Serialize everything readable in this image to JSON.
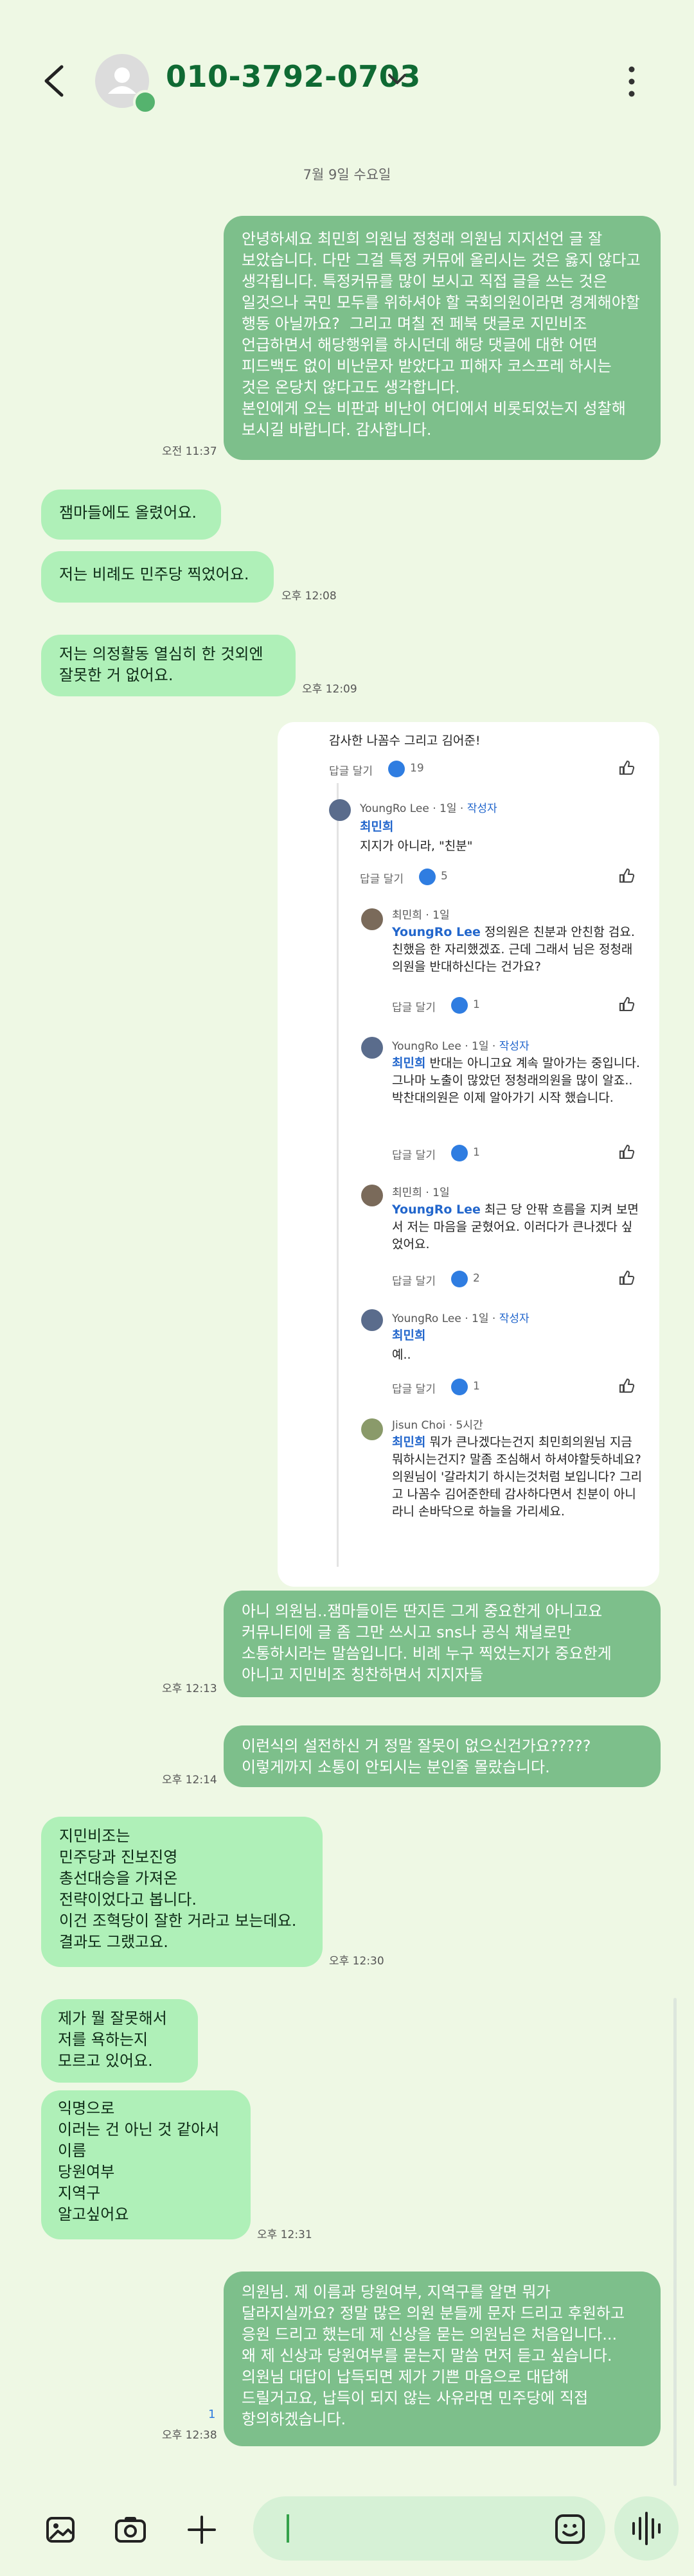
{
  "header": {
    "contact": "010-3792-0703"
  },
  "date_divider": "7월 9일 수요일",
  "messages": {
    "m1": {
      "text": "안녕하세요 최민희 의원님 정청래 의원님 지지선언 글 잘 보았습니다. 다만 그걸 특정 커뮤에 올리시는 것은 옳지 않다고 생각됩니다. 특정커뮤를 많이 보시고 직접 글을 쓰는 것은 일것으나 국민 모두를 위하셔야 할 국회의원이라면 경계해야할 행동 아닐까요?  그리고 며칠 전 페북 댓글로 지민비조 언급하면서 해당행위를 하시던데 해당 댓글에 대한 어떤 피드백도 없이 비난문자 받았다고 피해자 코스프레 하시는 것은 온당치 않다고도 생각합니다.\n본인에게 오는 비판과 비난이 어디에서 비롯되었는지 성찰해 보시길 바랍니다. 감사합니다.",
      "time": "오전 11:37"
    },
    "m2": {
      "text": "잼마들에도 올렸어요."
    },
    "m3": {
      "text": "저는 비례도 민주당 찍었어요.",
      "time": "오후 12:08"
    },
    "m4": {
      "text": "저는 의정활동 열심히 한 것외엔\n잘못한 거 없어요.",
      "time": "오후 12:09"
    },
    "m6": {
      "text": "아니 의원님..잼마들이든 딴지든 그게 중요한게 아니고요 커뮤니티에 글 좀 그만 쓰시고 sns나 공식 채널로만 소통하시라는 말씀입니다. 비례 누구 찍었는지가 중요한게 아니고 지민비조 칭찬하면서 지지자들",
      "time": "오후 12:13"
    },
    "m7": {
      "text": "이런식의 설전하신 거 정말 잘못이 없으신건가요?????\n이렇게까지 소통이 안되시는 분인줄 몰랐습니다.",
      "time": "오후 12:14"
    },
    "m8": {
      "text": "지민비조는\n민주당과 진보진영\n총선대승을 가져온\n전략이었다고 봅니다.\n이건 조혁당이 잘한 거라고 보는데요.\n결과도 그랬고요.",
      "time": "오후 12:30"
    },
    "m9": {
      "text": "제가 뭘 잘못해서\n저를 욕하는지\n모르고 있어요."
    },
    "m10": {
      "text": "익명으로\n이러는 건 아닌 것 같아서\n이름\n당원여부\n지역구\n알고싶어요",
      "time": "오후 12:31"
    },
    "m11": {
      "text": "의원님. 제 이름과 당원여부, 지역구를 알면 뭐가 달라지실까요? 정말 많은 의원 분들께 문자 드리고 후원하고 응원 드리고 했는데 제 신상을 묻는 의원님은 처음입니다...\n왜 제 신상과 당원여부를 묻는지 말씀 먼저 듣고 싶습니다.\n의원님 대답이 납득되면 제가 기쁜 마음으로 대답해 드릴거고요, 납득이 되지 않는 사유라면 민주당에 직접 항의하겠습니다.",
      "time": "오후 12:38",
      "unread": "1"
    }
  },
  "screenshot": {
    "c0_text": "감사한 나꼼수 그리고 김어준!",
    "c0_reply": "답글 달기",
    "c0_likes": "19",
    "c1_user": "YoungRo Lee",
    "c1_meta": "· 1일 ·",
    "c1_badge": "작성자",
    "c1_mention": "최민희",
    "c1_text": "지지가 아니라, \"친분\"",
    "c1_reply": "답글 달기",
    "c1_likes": "5",
    "c2_user": "최민희",
    "c2_meta": "· 1일",
    "c2_mention": "YoungRo Lee",
    "c2_text": "정의원은 친분과 안친함 검요.친했음 한 자리했겠죠. 근데 그래서 님은 정청래의원을 반대하신다는 건가요?",
    "c2_reply": "답글 달기",
    "c2_likes": "1",
    "c3_user": "YoungRo Lee",
    "c3_meta": "· 1일 ·",
    "c3_badge": "작성자",
    "c3_mention": "최민희",
    "c3_text": "반대는 아니고요 계속 말아가는 중입니다. 그나마 노출이 많았던 정청래의원을 많이 알죠.. 박찬대의원은 이제 알아가기 시작 했습니다.",
    "c3_reply": "답글 달기",
    "c3_likes": "1",
    "c4_user": "최민희",
    "c4_meta": "· 1일",
    "c4_mention": "YoungRo Lee",
    "c4_text": "최근 당 안팎 흐름을 지켜 보면서 저는 마음을 굳혔어요. 이러다가 큰나겠다 싶었어요.",
    "c4_reply": "답글 달기",
    "c4_likes": "2",
    "c5_user": "YoungRo Lee",
    "c5_meta": "· 1일 ·",
    "c5_badge": "작성자",
    "c5_mention": "최민희",
    "c5_text": "예..",
    "c5_reply": "답글 달기",
    "c5_likes": "1",
    "c6_user": "Jisun Choi",
    "c6_meta": "· 5시간",
    "c6_mention": "최민희",
    "c6_text": "뭐가 큰나겠다는건지 최민희의원님 지금 뭐하시는건지? 말좀 조심해서 하셔야할듯하네요? 의원님이 '갈라치기 하시는것처럼 보입니다? 그리고 나꼼수 김어준한테 감사하다면서 친분이 아니라니 손바닥으로 하늘을 가리세요."
  },
  "colors": {
    "background": "#eef8e4",
    "outgoing_bubble": "#7dbf8b",
    "incoming_bubble": "#aff0b8",
    "accent": "#0f6a33"
  },
  "icons": [
    "back-arrow-icon",
    "person-icon",
    "chevron-down-icon",
    "more-vert-icon",
    "gallery-icon",
    "camera-icon",
    "plus-icon",
    "emoji-icon",
    "voice-wave-icon",
    "thumb-up-icon"
  ]
}
